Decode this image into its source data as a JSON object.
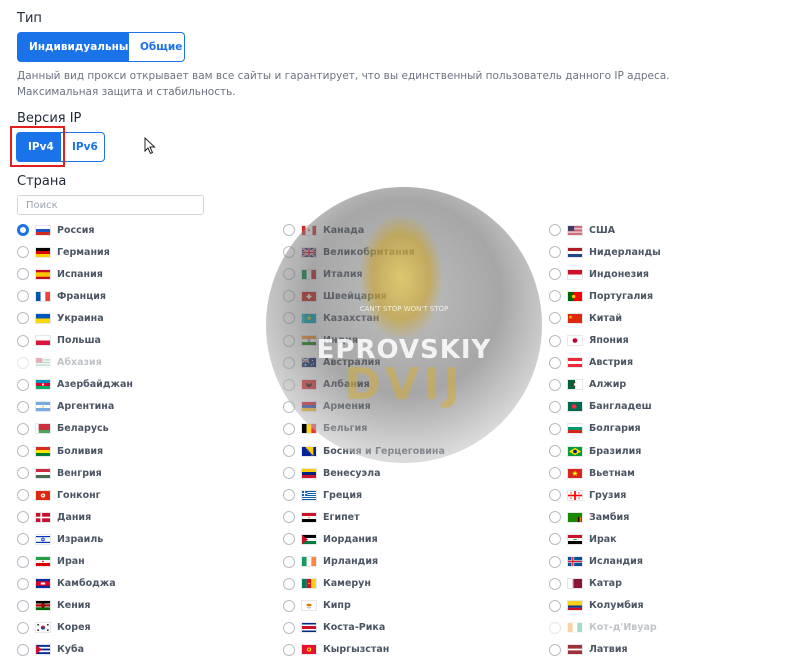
{
  "type_section": {
    "title": "Тип",
    "options": [
      {
        "label": "Индивидуальные",
        "active": true
      },
      {
        "label": "Общие",
        "active": false
      }
    ],
    "description_line1": "Данный вид прокси открывает вам все сайты и гарантирует, что вы единственный пользователь данного IP адреса.",
    "description_line2": "Максимальная защита и стабильность."
  },
  "ip_section": {
    "title": "Версия IP",
    "options": [
      {
        "label": "IPv4",
        "active": true
      },
      {
        "label": "IPv6",
        "active": false
      }
    ]
  },
  "country_section": {
    "title": "Страна",
    "search_placeholder": "Поиск",
    "selected": "Россия",
    "columns": [
      [
        {
          "name": "Россия",
          "flag": "ru"
        },
        {
          "name": "Германия",
          "flag": "de"
        },
        {
          "name": "Испания",
          "flag": "es"
        },
        {
          "name": "Франция",
          "flag": "fr"
        },
        {
          "name": "Украина",
          "flag": "ua"
        },
        {
          "name": "Польша",
          "flag": "pl"
        },
        {
          "name": "Абхазия",
          "flag": "ab",
          "disabled": true
        },
        {
          "name": "Азербайджан",
          "flag": "az"
        },
        {
          "name": "Аргентина",
          "flag": "ar"
        },
        {
          "name": "Беларусь",
          "flag": "by"
        },
        {
          "name": "Боливия",
          "flag": "bo"
        },
        {
          "name": "Венгрия",
          "flag": "hu"
        },
        {
          "name": "Гонконг",
          "flag": "hk"
        },
        {
          "name": "Дания",
          "flag": "dk"
        },
        {
          "name": "Израиль",
          "flag": "il"
        },
        {
          "name": "Иран",
          "flag": "ir"
        },
        {
          "name": "Камбоджа",
          "flag": "kh"
        },
        {
          "name": "Кения",
          "flag": "ke"
        },
        {
          "name": "Корея",
          "flag": "kr"
        },
        {
          "name": "Куба",
          "flag": "cu"
        }
      ],
      [
        {
          "name": "Канада",
          "flag": "ca"
        },
        {
          "name": "Великобритания",
          "flag": "gb"
        },
        {
          "name": "Италия",
          "flag": "it"
        },
        {
          "name": "Швейцария",
          "flag": "ch"
        },
        {
          "name": "Казахстан",
          "flag": "kz"
        },
        {
          "name": "Индия",
          "flag": "in"
        },
        {
          "name": "Австралия",
          "flag": "au"
        },
        {
          "name": "Албания",
          "flag": "al"
        },
        {
          "name": "Армения",
          "flag": "am"
        },
        {
          "name": "Бельгия",
          "flag": "be"
        },
        {
          "name": "Босния и Герцеговина",
          "flag": "ba"
        },
        {
          "name": "Венесуэла",
          "flag": "ve"
        },
        {
          "name": "Греция",
          "flag": "gr"
        },
        {
          "name": "Египет",
          "flag": "eg"
        },
        {
          "name": "Иордания",
          "flag": "jo"
        },
        {
          "name": "Ирландия",
          "flag": "ie"
        },
        {
          "name": "Камерун",
          "flag": "cm"
        },
        {
          "name": "Кипр",
          "flag": "cy"
        },
        {
          "name": "Коста-Рика",
          "flag": "cr"
        },
        {
          "name": "Кыргызстан",
          "flag": "kg"
        }
      ],
      [
        {
          "name": "США",
          "flag": "us"
        },
        {
          "name": "Нидерланды",
          "flag": "nl"
        },
        {
          "name": "Индонезия",
          "flag": "id"
        },
        {
          "name": "Португалия",
          "flag": "pt"
        },
        {
          "name": "Китай",
          "flag": "cn"
        },
        {
          "name": "Япония",
          "flag": "jp"
        },
        {
          "name": "Австрия",
          "flag": "at"
        },
        {
          "name": "Алжир",
          "flag": "dz"
        },
        {
          "name": "Бангладеш",
          "flag": "bd"
        },
        {
          "name": "Болгария",
          "flag": "bg"
        },
        {
          "name": "Бразилия",
          "flag": "br"
        },
        {
          "name": "Вьетнам",
          "flag": "vn"
        },
        {
          "name": "Грузия",
          "flag": "ge"
        },
        {
          "name": "Замбия",
          "flag": "zm"
        },
        {
          "name": "Ирак",
          "flag": "iq"
        },
        {
          "name": "Исландия",
          "flag": "is"
        },
        {
          "name": "Катар",
          "flag": "qa"
        },
        {
          "name": "Колумбия",
          "flag": "co"
        },
        {
          "name": "Кот-д'Ивуар",
          "flag": "ci",
          "disabled": true
        },
        {
          "name": "Латвия",
          "flag": "lv"
        }
      ]
    ]
  },
  "watermark": {
    "line_small": "CAN'T STOP WON'T STOP",
    "line1": "EPROVSKIY",
    "line2": "DVIJ"
  }
}
